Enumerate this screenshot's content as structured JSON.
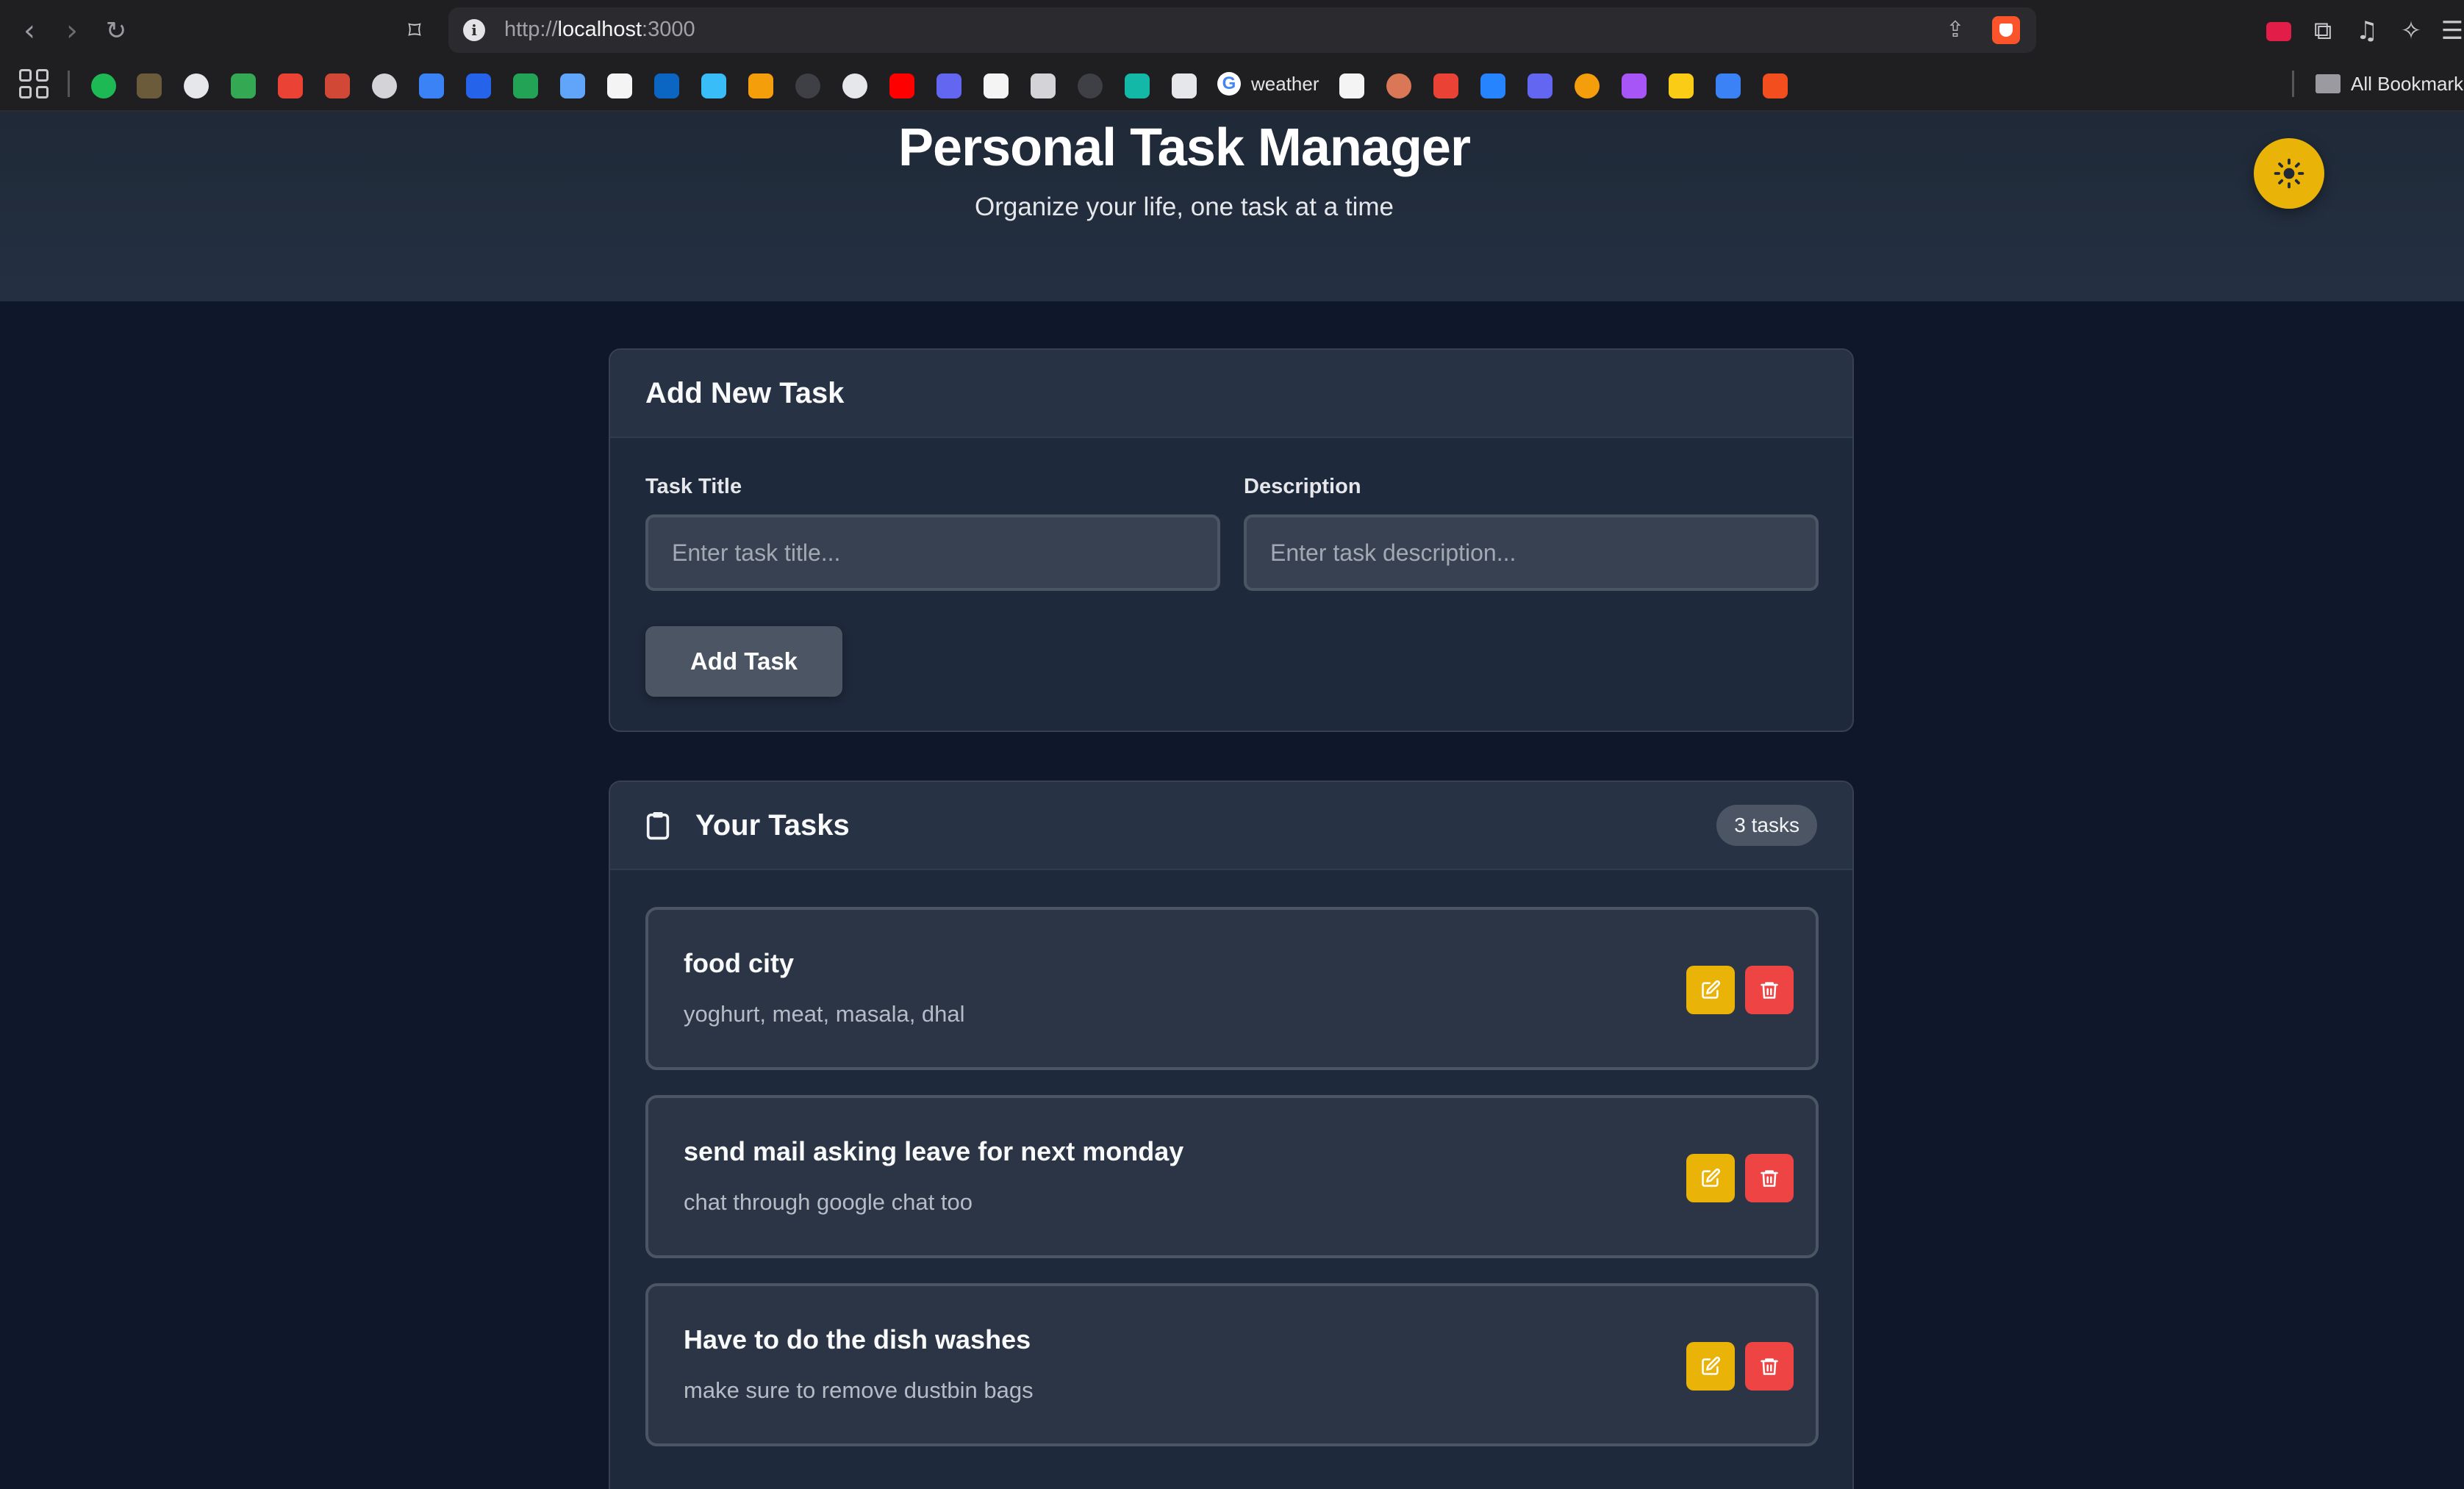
{
  "browser": {
    "url_scheme": "http://",
    "url_host": "localhost",
    "url_port": ":3000",
    "bookmarks": {
      "weather_label": "weather",
      "all_bookmarks_label": "All Bookmarks"
    },
    "bookmark_icons": [
      "spotify-icon",
      "assistant-icon",
      "globe-icon",
      "chat-icon",
      "gmail-icon",
      "gmail-icon",
      "openai-icon",
      "tick-icon",
      "k-icon",
      "sheet-icon",
      "star-icon",
      "notion-icon",
      "linkedin-icon",
      "tailwind-icon",
      "gitkraken-icon",
      "github-icon",
      "globe-icon",
      "youtube-icon",
      "shield-icon",
      "binance-icon",
      "paper-icon",
      "perplexity-icon",
      "chart-icon",
      "logo-icon",
      "google-icon",
      "perplexity-icon",
      "claude-icon",
      "gmail-icon",
      "jira-icon",
      "dev-icon",
      "sun-icon",
      "heart-icon",
      "note-icon",
      "folder-icon",
      "figma-icon"
    ]
  },
  "header": {
    "title": "Personal Task Manager",
    "subtitle": "Organize your life, one task at a time",
    "theme_toggle_icon": "sun-icon"
  },
  "add_task": {
    "heading": "Add New Task",
    "title_label": "Task Title",
    "title_placeholder": "Enter task title...",
    "description_label": "Description",
    "description_placeholder": "Enter task description...",
    "submit_label": "Add Task"
  },
  "tasks": {
    "heading": "Your Tasks",
    "heading_icon": "clipboard-icon",
    "count_label": "3 tasks",
    "items": [
      {
        "title": "food city",
        "description": "yoghurt, meat, masala, dhal"
      },
      {
        "title": "send mail asking leave for next monday",
        "description": "chat through google chat too"
      },
      {
        "title": "Have to do the dish washes",
        "description": "make sure to remove dustbin bags"
      }
    ]
  },
  "colors": {
    "page_bg": "#0f172a",
    "accent_yellow": "#eab308",
    "danger_red": "#ef4444"
  }
}
